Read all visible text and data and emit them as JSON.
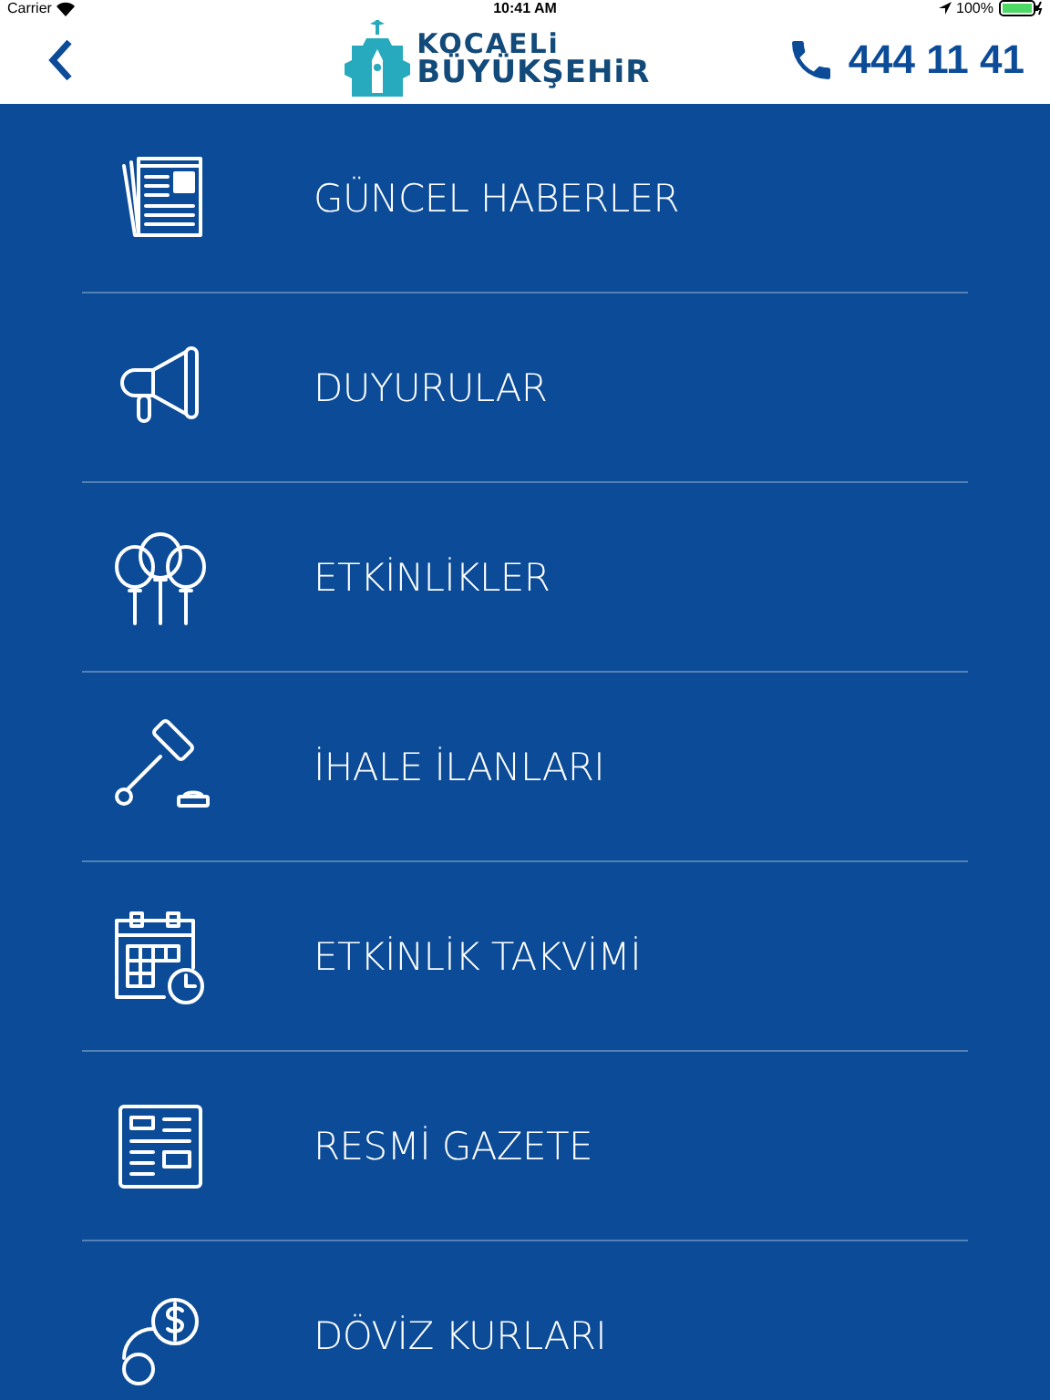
{
  "status_bar": {
    "carrier": "Carrier",
    "time": "10:41 AM",
    "battery": "100%"
  },
  "header": {
    "logo_line_1": "KOCAELi",
    "logo_line_2": "BÜYÜKŞEHiR",
    "phone": "444 11 41"
  },
  "menu": [
    {
      "kind": "news",
      "label": "GÜNCEL HABERLER"
    },
    {
      "kind": "megaphone",
      "label": "DUYURULAR"
    },
    {
      "kind": "balloons",
      "label": "ETKİNLİKLER"
    },
    {
      "kind": "gavel",
      "label": "İHALE İLANLARI"
    },
    {
      "kind": "calendar",
      "label": "ETKİNLİK TAKVİMİ"
    },
    {
      "kind": "gazette",
      "label": "RESMİ GAZETE"
    },
    {
      "kind": "currency",
      "label": "DÖVİZ KURLARI"
    }
  ]
}
